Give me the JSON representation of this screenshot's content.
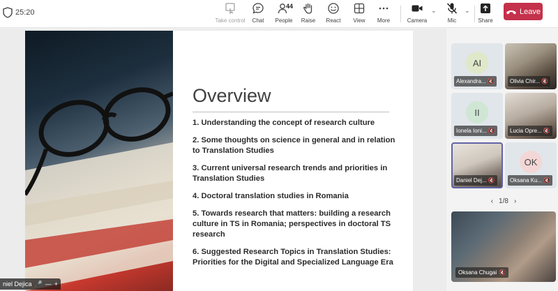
{
  "toolbar": {
    "timer": "25:20",
    "buttons": {
      "take_control": "Take control",
      "chat": "Chat",
      "people": "People",
      "people_count": "44",
      "raise": "Raise",
      "react": "React",
      "view": "View",
      "more": "More",
      "camera": "Camera",
      "mic": "Mic",
      "share": "Share"
    },
    "leave": "Leave",
    "leave_color": "#c4314b"
  },
  "slide": {
    "title": "Overview",
    "items": [
      "1. Understanding the concept of research culture",
      "2. Some thoughts on science in general and in relation to Translation Studies",
      "3. Current universal research trends and priorities in Translation Studies",
      "4. Doctoral translation studies in Romania",
      "5. Towards research that matters: building a research culture in TS in Romania; perspectives in doctoral TS research",
      "6. Suggested Research Topics in Translation Studies: Priorities for the Digital and Specialized Language Era"
    ],
    "presenter": "niel Dejica"
  },
  "gallery": {
    "tiles": [
      {
        "initials": "AI",
        "name": "Alexandra...",
        "avatar_color": "#dfe8c9"
      },
      {
        "initials": "",
        "name": "Olivia Chir...",
        "avatar_color": ""
      },
      {
        "initials": "II",
        "name": "Ionela Ioni...",
        "avatar_color": "#cfe6d4"
      },
      {
        "initials": "",
        "name": "Lucia Opre...",
        "avatar_color": ""
      },
      {
        "initials": "",
        "name": "Daniel Dej...",
        "avatar_color": ""
      },
      {
        "initials": "OK",
        "name": "Oksana Ku...",
        "avatar_color": "#f3d6d6"
      }
    ],
    "page": "1/8",
    "featured_name": "Oksana Chugai"
  },
  "accent": "#6264a7"
}
